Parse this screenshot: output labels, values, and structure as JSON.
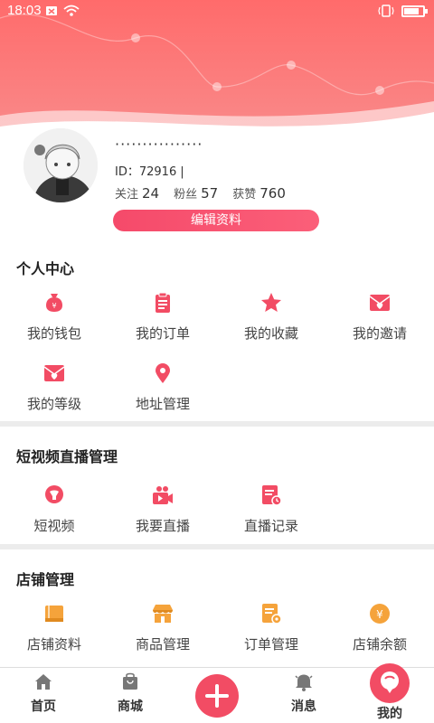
{
  "status_bar": {
    "time": "18:03"
  },
  "profile": {
    "nickname": "················",
    "id_label": "ID：",
    "id_value": "72916",
    "follow_label": "关注",
    "follow_count": "24",
    "fans_label": "粉丝",
    "fans_count": "57",
    "likes_label": "获赞",
    "likes_count": "760",
    "edit_button": "编辑资料"
  },
  "personal_center": {
    "title": "个人中心",
    "items": [
      {
        "label": "我的钱包",
        "icon": "wallet-icon"
      },
      {
        "label": "我的订单",
        "icon": "order-icon"
      },
      {
        "label": "我的收藏",
        "icon": "star-icon"
      },
      {
        "label": "我的邀请",
        "icon": "invite-mail-icon"
      },
      {
        "label": "我的等级",
        "icon": "level-mail-icon"
      },
      {
        "label": "地址管理",
        "icon": "location-icon"
      }
    ]
  },
  "video_live": {
    "title": "短视频直播管理",
    "items": [
      {
        "label": "短视频",
        "icon": "short-video-icon"
      },
      {
        "label": "我要直播",
        "icon": "camera-icon"
      },
      {
        "label": "直播记录",
        "icon": "live-record-icon"
      }
    ]
  },
  "shop": {
    "title": "店铺管理",
    "items": [
      {
        "label": "店铺资料",
        "icon": "shop-profile-icon"
      },
      {
        "label": "商品管理",
        "icon": "store-icon"
      },
      {
        "label": "订单管理",
        "icon": "order-manage-icon"
      },
      {
        "label": "店铺余额",
        "icon": "yen-coin-icon"
      }
    ]
  },
  "bottom_nav": {
    "home": "首页",
    "mall": "商城",
    "messages": "消息",
    "mine": "我的"
  },
  "colors": {
    "brand": "#f24c64",
    "header": "#ff6b6b",
    "shop_accent": "#f5a33b"
  }
}
